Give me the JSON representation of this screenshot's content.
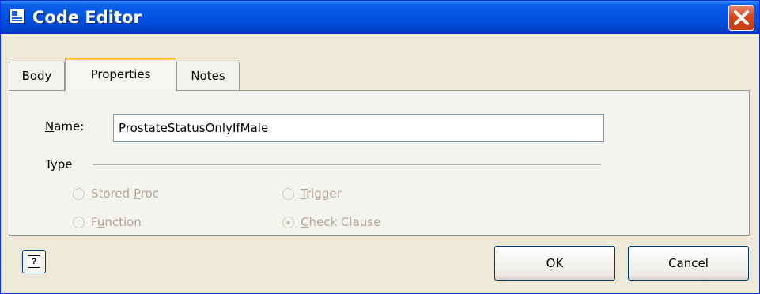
{
  "window": {
    "title": "Code Editor"
  },
  "tabs": [
    {
      "label": "Body",
      "active": false
    },
    {
      "label": "Properties",
      "active": true
    },
    {
      "label": "Notes",
      "active": false
    }
  ],
  "properties": {
    "name_label_hotkey": "N",
    "name_label_rest": "ame:",
    "name_value": "ProstateStatusOnlyIfMale",
    "type_label": "Type",
    "type_options": [
      {
        "pre": "Stored ",
        "hot": "P",
        "post": "roc",
        "selected": false,
        "enabled": false
      },
      {
        "pre": "",
        "hot": "T",
        "post": "rigger",
        "selected": false,
        "enabled": false
      },
      {
        "pre": "F",
        "hot": "u",
        "post": "nction",
        "selected": false,
        "enabled": false
      },
      {
        "pre": "",
        "hot": "C",
        "post": "heck Clause",
        "selected": true,
        "enabled": false
      }
    ]
  },
  "buttons": {
    "ok": "OK",
    "cancel": "Cancel",
    "help_icon": "help-icon"
  },
  "colors": {
    "titlebar": "#0054e3",
    "face": "#ece9d8",
    "tab_highlight": "#ffc83c",
    "close": "#d9481d"
  }
}
